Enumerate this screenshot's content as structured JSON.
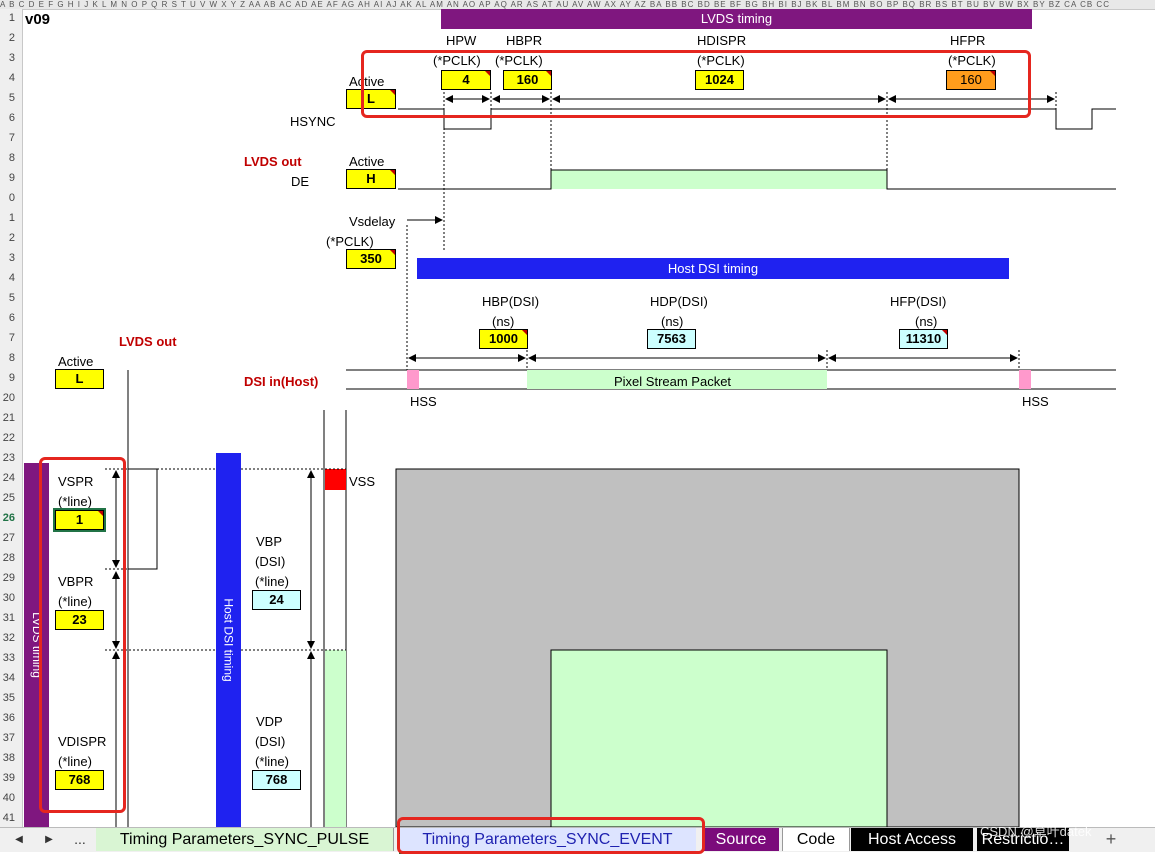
{
  "sheet": {
    "column_header_text": "A  B  C D E  F G H I J K L M N O P Q R S  T  U  V W X Y Z AA AB AC AD AE AF AG AH AI AJ AK AL AM AN AO AP AQ AR AS AT AU AV AW AX AY AZ BA BB BC BD BE BF BG BH BI BJ BK BL BM BN BO BP BQ BR BS BT BU BV BW BX BY BZ CA CB CC",
    "row_numbers": [
      "1",
      "2",
      "3",
      "4",
      "5",
      "6",
      "7",
      "8",
      "9",
      "0",
      "1",
      "2",
      "3",
      "4",
      "5",
      "6",
      "7",
      "8",
      "9",
      "20",
      "21",
      "22",
      "23",
      "24",
      "25",
      "26",
      "27",
      "28",
      "29",
      "30",
      "31",
      "32",
      "33",
      "34",
      "35",
      "36",
      "37",
      "38",
      "39",
      "40",
      "41"
    ],
    "active_row": "26",
    "version": "v09"
  },
  "lvds": {
    "banner": "LVDS timing",
    "params": [
      {
        "name": "HPW",
        "unit": "(*PCLK)",
        "value": "4"
      },
      {
        "name": "HBPR",
        "unit": "(*PCLK)",
        "value": "160"
      },
      {
        "name": "HDISPR",
        "unit": "(*PCLK)",
        "value": "1024"
      },
      {
        "name": "HFPR",
        "unit": "(*PCLK)",
        "value": "160"
      }
    ],
    "hsync_active_label": "Active",
    "hsync_active_value": "L",
    "hsync_label": "HSYNC",
    "out_label": "LVDS out",
    "de_active_label": "Active",
    "de_active_value": "H",
    "de_label": "DE",
    "vsdelay_label": "Vsdelay",
    "vsdelay_unit": "(*PCLK)",
    "vsdelay_value": "350"
  },
  "dsi": {
    "banner": "Host DSI timing",
    "params": [
      {
        "name": "HBP(DSI)",
        "unit": "(ns)",
        "value": "1000"
      },
      {
        "name": "HDP(DSI)",
        "unit": "(ns)",
        "value": "7563"
      },
      {
        "name": "HFP(DSI)",
        "unit": "(ns)",
        "value": "11310"
      }
    ],
    "in_label": "DSI in(Host)",
    "packet_label": "Pixel Stream Packet",
    "hss_left": "HSS",
    "hss_right": "HSS"
  },
  "vertical": {
    "lvds_out_label": "LVDS out",
    "active_label": "Active",
    "active_value": "L",
    "lvds_banner": "LVDS timing",
    "dsi_banner": "Host DSI timing",
    "vspr": {
      "name": "VSPR",
      "unit": "(*line)",
      "value": "1"
    },
    "vbpr": {
      "name": "VBPR",
      "unit": "(*line)",
      "value": "23"
    },
    "vdispr": {
      "name": "VDISPR",
      "unit": "(*line)",
      "value": "768"
    },
    "vbp": {
      "name": "VBP",
      "sub": "(DSI)",
      "unit": "(*line)",
      "value": "24"
    },
    "vdp": {
      "name": "VDP",
      "sub": "(DSI)",
      "unit": "(*line)",
      "value": "768"
    },
    "vss_label": "VSS"
  },
  "tabs": {
    "nav_prev": "◀",
    "nav_next": "▶",
    "nav_more": "...",
    "items": [
      {
        "label": "Timing Parameters_SYNC_PULSE",
        "color": "#d9f5d3"
      },
      {
        "label": "Timing Parameters_SYNC_EVENT",
        "color": "#dde4ff"
      },
      {
        "label": "Source",
        "color": "#7b0b7b"
      },
      {
        "label": "Code",
        "color": "#ffffff"
      },
      {
        "label": "Host Access",
        "color": "#000000"
      },
      {
        "label": "Restrictio…",
        "color": "#000000"
      }
    ],
    "add_sheet": "+"
  },
  "watermark": "CSDN @草叶datek",
  "colors": {
    "lvds_banner": "#7f177f",
    "dsi_banner": "#1f22f0",
    "active_green": "#ccffcc",
    "gray_area": "#c0c0c0",
    "input_yellow": "#ffff00",
    "input_orange": "#ff9d1c",
    "input_cyan": "#ccffff",
    "highlight_red": "#e5261f",
    "label_red": "#c00000"
  }
}
